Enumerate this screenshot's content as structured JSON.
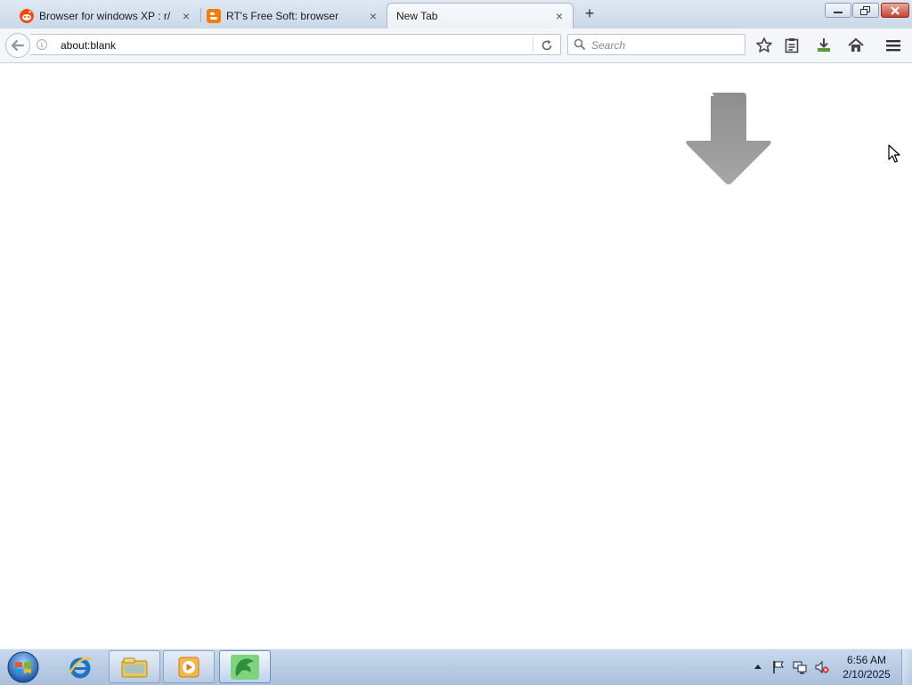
{
  "browser": {
    "tabs": [
      {
        "title": "Browser for windows XP : r/",
        "favicon": "reddit-icon",
        "color": "#ff4500",
        "active": false
      },
      {
        "title": "RT's Free Soft: browser",
        "favicon": "blogger-icon",
        "color": "#f57d00",
        "active": false
      },
      {
        "title": "New Tab",
        "favicon": "none",
        "active": true
      }
    ],
    "tab_close_glyph": "×",
    "new_tab_glyph": "+",
    "url": "about:blank",
    "search_placeholder": "Search",
    "toolbar_icons": [
      "bookmark-star-icon",
      "reading-list-icon",
      "download-icon",
      "home-icon",
      "menu-icon"
    ]
  },
  "content": {
    "arrow_color": "#9a9a9a",
    "cursor": "pointer-cursor-icon"
  },
  "taskbar": {
    "start": "windows-start-icon",
    "apps": [
      {
        "name": "internet-explorer-icon",
        "state": "pinned"
      },
      {
        "name": "file-explorer-icon",
        "state": "open"
      },
      {
        "name": "media-player-icon",
        "state": "open"
      },
      {
        "name": "browser-app-icon",
        "state": "active"
      }
    ],
    "tray_icons": [
      "show-hidden-icons",
      "action-center-flag-icon",
      "network-icon",
      "volume-muted-icon"
    ],
    "time": "6:56 AM",
    "date": "2/10/2025"
  }
}
